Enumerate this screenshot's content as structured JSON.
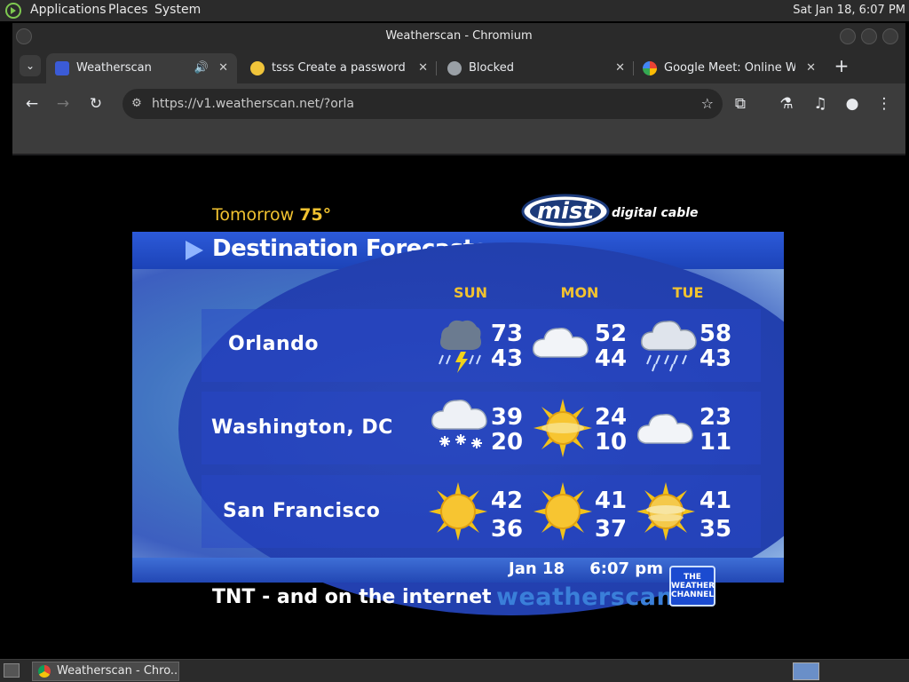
{
  "top_panel": {
    "applications": "Applications",
    "places": "Places",
    "system": "System",
    "clock": "Sat Jan 18,  6:07 PM"
  },
  "window": {
    "title": "Weatherscan - Chromium"
  },
  "tabs": [
    {
      "title": "Weatherscan",
      "close": "✕",
      "favicon_color": "#3b5bd6"
    },
    {
      "title": "tsss Create a password-p",
      "close": "✕",
      "favicon_color": "#f0c43a"
    },
    {
      "title": "Blocked",
      "close": "✕",
      "favicon_color": "#9aa0a6"
    },
    {
      "title": "Google Meet: Online Web",
      "close": "✕",
      "favicon_color": "#ffffff"
    }
  ],
  "toolbar": {
    "url": "https://v1.weatherscan.net/?orla"
  },
  "weatherscan": {
    "tomorrow_label": "Tomorrow",
    "tomorrow_temp": "75°",
    "logo_text": "mist",
    "logo_sub": "digital cable",
    "section_title": "Destination Forecasts",
    "days": [
      "SUN",
      "MON",
      "TUE"
    ],
    "cities": [
      {
        "name": "Orlando",
        "forecast": [
          {
            "icon": "thunderstorm-icon",
            "high": "73",
            "low": "43"
          },
          {
            "icon": "cloudy-icon",
            "high": "52",
            "low": "44"
          },
          {
            "icon": "rain-icon",
            "high": "58",
            "low": "43"
          }
        ]
      },
      {
        "name": "Washington, DC",
        "forecast": [
          {
            "icon": "snow-icon",
            "high": "39",
            "low": "20"
          },
          {
            "icon": "sunny-icon",
            "high": "24",
            "low": "10"
          },
          {
            "icon": "cloudy-icon",
            "high": "23",
            "low": "11"
          }
        ]
      },
      {
        "name": "San Francisco",
        "forecast": [
          {
            "icon": "sunny-icon",
            "high": "42",
            "low": "36"
          },
          {
            "icon": "sunny-icon",
            "high": "41",
            "low": "37"
          },
          {
            "icon": "hazy-sun-icon",
            "high": "41",
            "low": "35"
          }
        ]
      }
    ],
    "date": "Jan 18",
    "time": "6:07 pm",
    "crawl": "TNT - and on the internet",
    "brand": "weatherscan",
    "channel_line1": "THE",
    "channel_line2": "WEATHER",
    "channel_line3": "CHANNEL"
  },
  "taskbar": {
    "window_button": "Weatherscan - Chro..."
  },
  "colors": {
    "accent_yellow": "#f1c230",
    "banner_blue": "#2c5ad8",
    "brand_blue": "#3a7fd9"
  }
}
